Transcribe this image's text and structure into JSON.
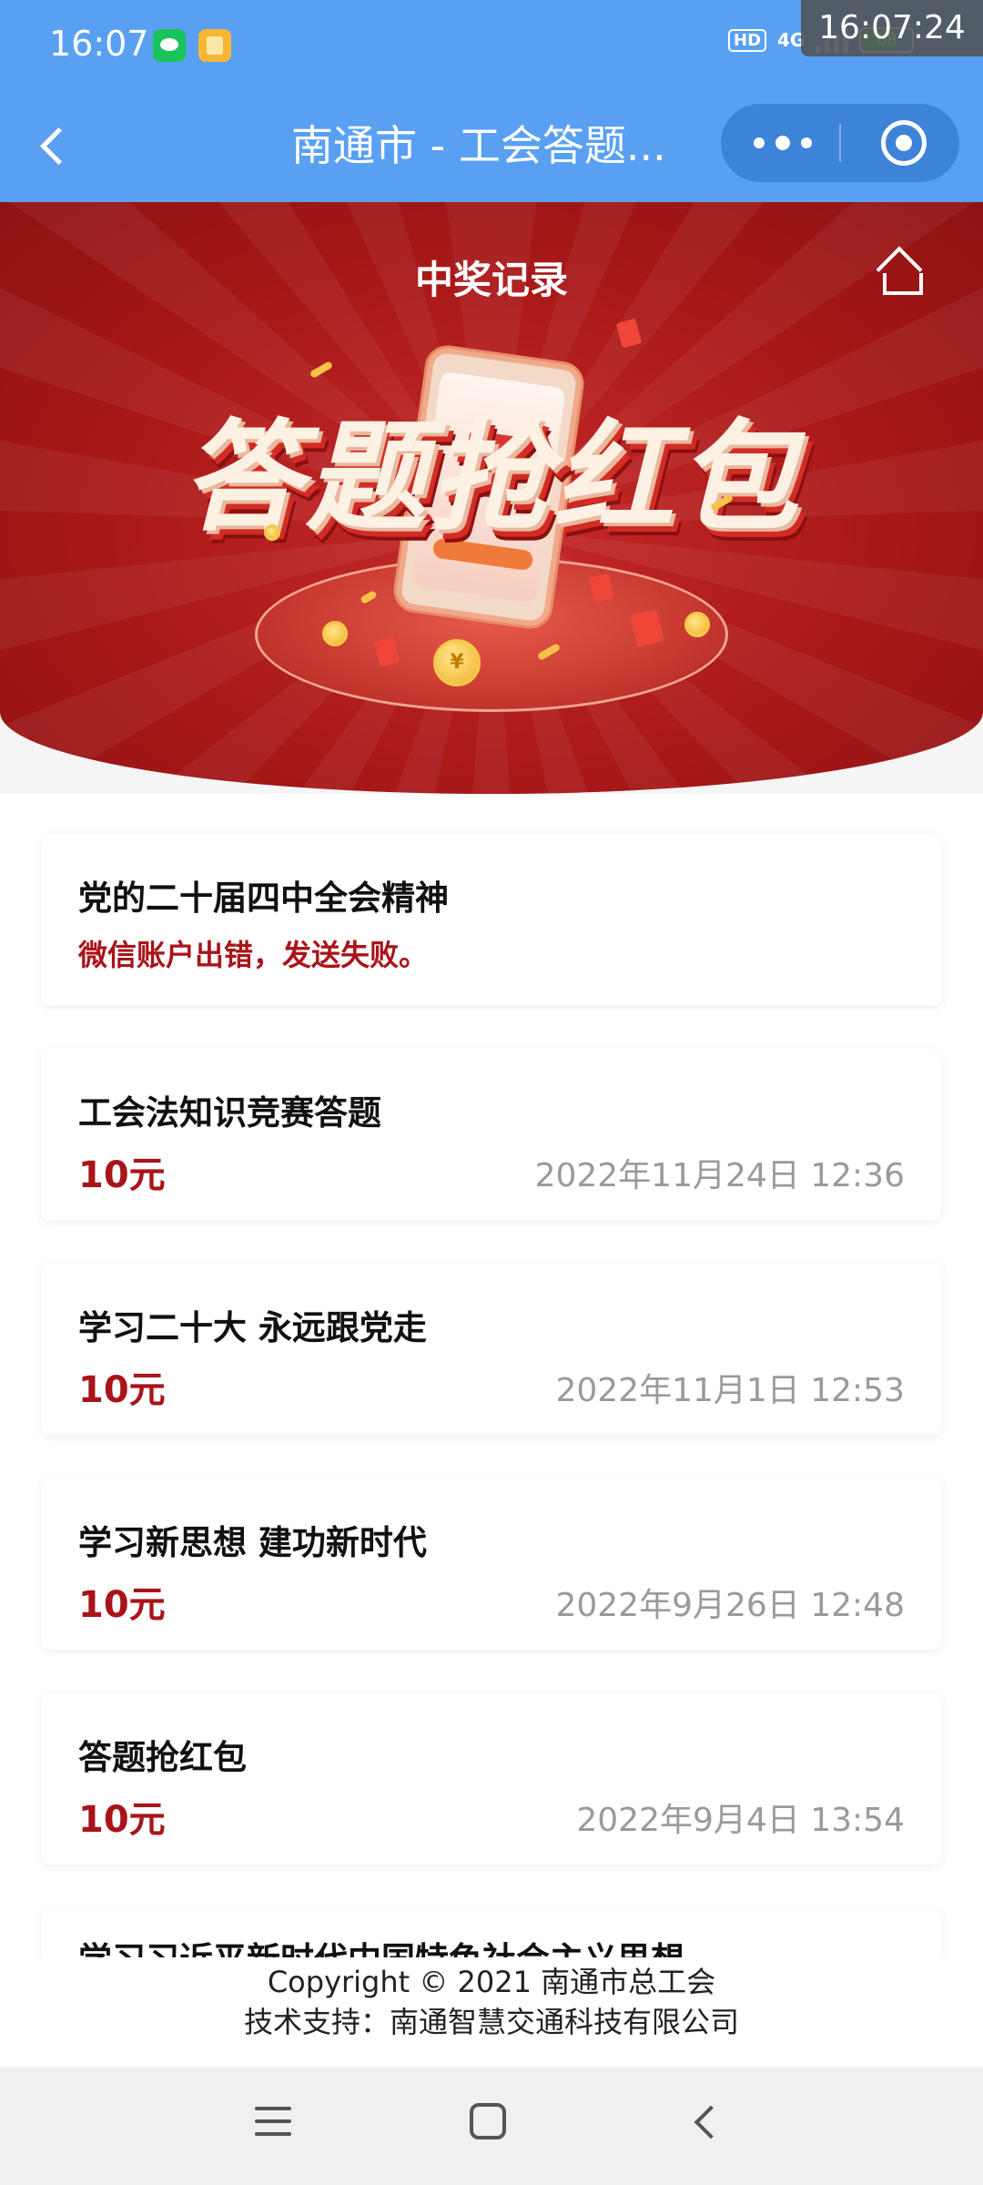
{
  "status_bar": {
    "time": "16:07",
    "network": "4G",
    "hd": "HD",
    "battery": "68",
    "clock_overlay": "16:07:24"
  },
  "title_bar": {
    "title": "南通市 - 工会答题..."
  },
  "banner": {
    "page_title": "中奖记录",
    "slogan": "答题抢红包",
    "coin_symbol": "¥"
  },
  "records": [
    {
      "title": "党的二十届四中全会精神",
      "error": "微信账户出错，发送失败。"
    },
    {
      "title": "工会法知识竞赛答题",
      "amount": "10元",
      "time": "2022年11月24日 12:36"
    },
    {
      "title": "学习二十大 永远跟党走",
      "amount": "10元",
      "time": "2022年11月1日 12:53"
    },
    {
      "title": "学习新思想 建功新时代",
      "amount": "10元",
      "time": "2022年9月26日 12:48"
    },
    {
      "title": "答题抢红包",
      "amount": "10元",
      "time": "2022年9月4日 13:54"
    },
    {
      "title": "学习习近平新时代中国特色社会主义思想"
    }
  ],
  "footer": {
    "copyright": "Copyright © 2021 南通市总工会",
    "support": "技术支持：南通智慧交通科技有限公司"
  },
  "colors": {
    "header_blue": "#5aa0f2",
    "banner_red": "#a91818",
    "amount_red": "#a9141a",
    "muted_gray": "#9a9a9a"
  },
  "icons": [
    "back-icon",
    "more-icon",
    "close-miniprogram-icon",
    "home-icon",
    "nav-menu-icon",
    "nav-home-icon",
    "nav-back-icon"
  ]
}
